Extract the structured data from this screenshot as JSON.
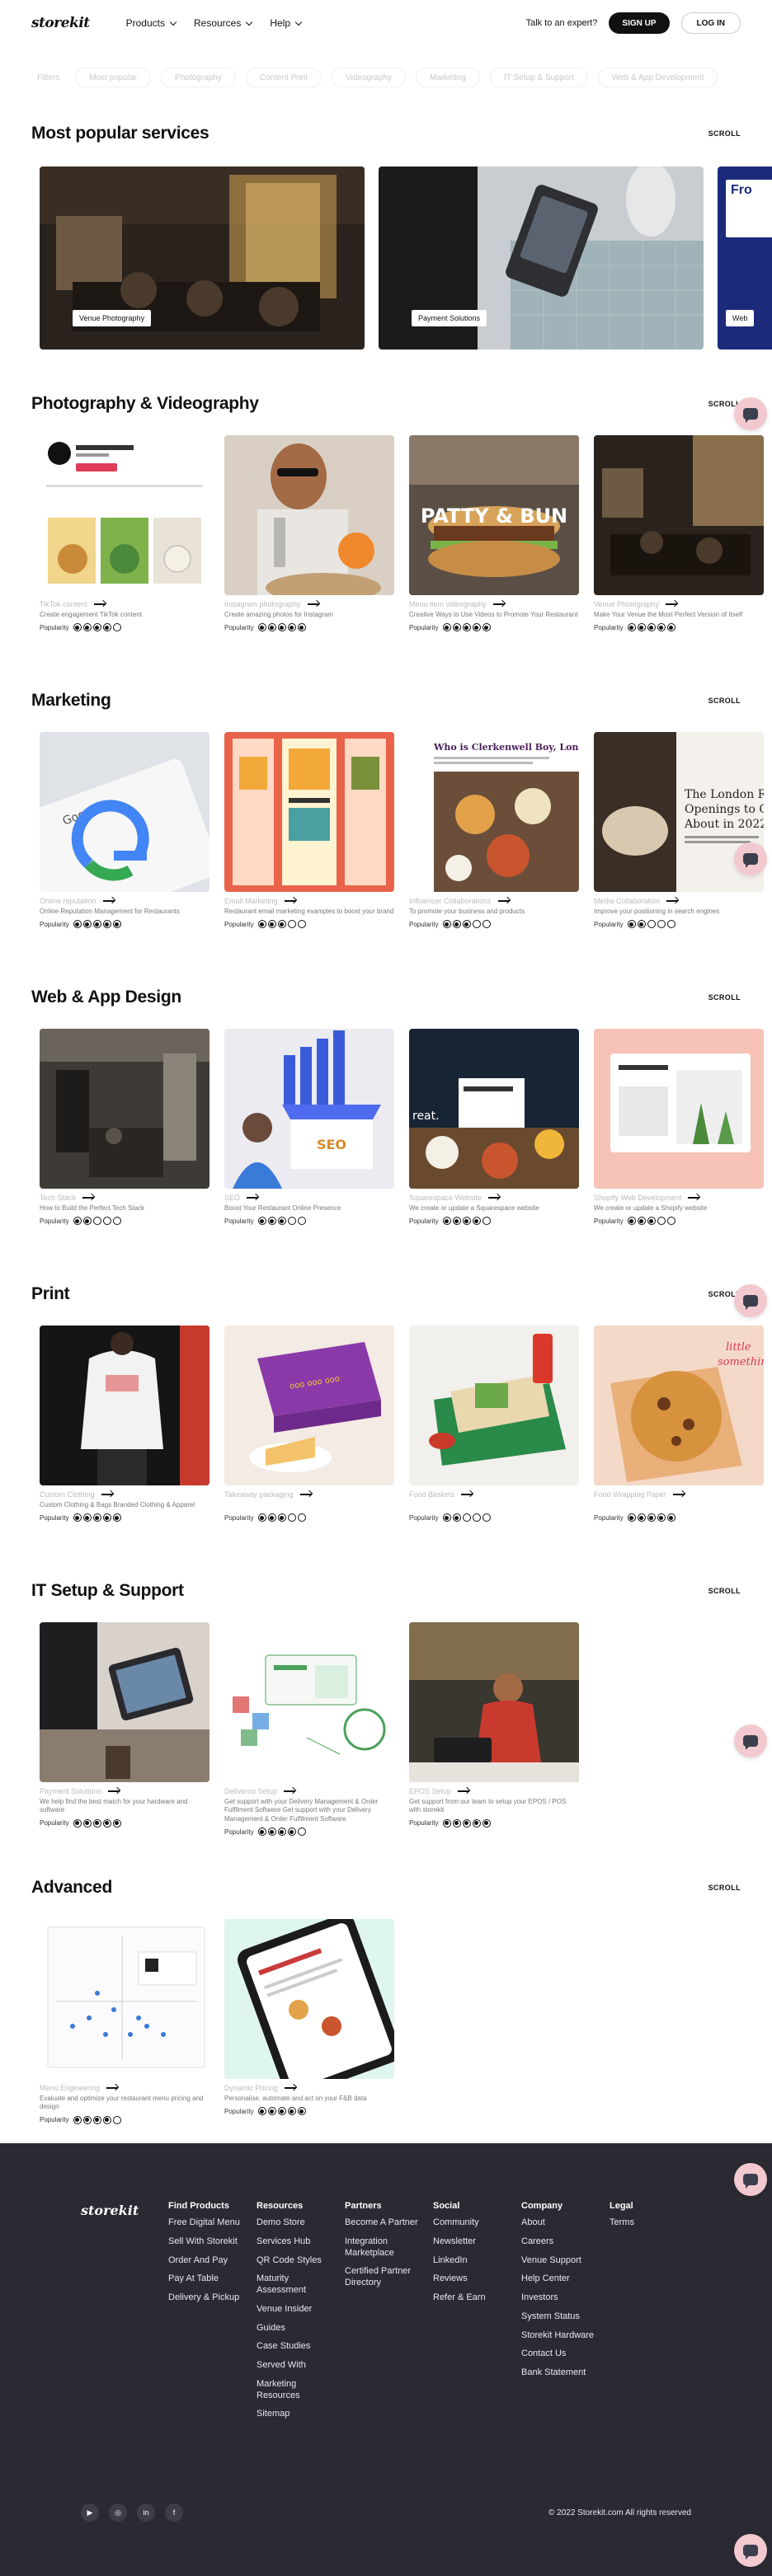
{
  "header": {
    "logo": "storekit",
    "nav": [
      "Products",
      "Resources",
      "Help"
    ],
    "talk": "Talk to an expert?",
    "signup": "SIGN UP",
    "login": "LOG IN"
  },
  "filters": [
    "Filters",
    "Most popular",
    "Photography",
    "Content Print",
    "Videography",
    "Marketing",
    "IT Setup & Support",
    "Web & App Development"
  ],
  "scroll_label": "SCROLL",
  "popular": {
    "title": "Most popular services",
    "cards": [
      {
        "label": "Venue Photography"
      },
      {
        "label": "Payment Solutions"
      },
      {
        "label": "Web"
      }
    ]
  },
  "popularity_label": "Popularity",
  "sections": [
    {
      "title": "Photography & Videography",
      "cards": [
        {
          "title": "TikTok content",
          "desc": "Create engagement TikTok content",
          "rating": 4
        },
        {
          "title": "Instagram photography",
          "desc": "Create amazing photos for Instagram",
          "rating": 5
        },
        {
          "title": "Menu item videography",
          "desc": "Creative Ways to Use Videos to Promote Your Restaurant",
          "rating": 5
        },
        {
          "title": "Venue Photography",
          "desc": "Make Your Venue the Most Perfect Version of Itself",
          "rating": 5
        }
      ]
    },
    {
      "title": "Marketing",
      "cards": [
        {
          "title": "Online reputation",
          "desc": "Online Reputation Management for Restaurants",
          "rating": 5
        },
        {
          "title": "Email Marketing",
          "desc": "Restaurant email marketing examples to boost your brand",
          "rating": 3
        },
        {
          "title": "Influencer Collaborations",
          "desc": "To promote your business and products",
          "rating": 3
        },
        {
          "title": "Media Collaboration",
          "desc": "Improve your positioning in search engines",
          "rating": 2
        }
      ]
    },
    {
      "title": "Web & App Design",
      "cards": [
        {
          "title": "Tech Stack",
          "desc": "How to Build the Perfect Tech Stack",
          "rating": 2
        },
        {
          "title": "SEO",
          "desc": "Boost Your Restaurant Online Presence",
          "rating": 3
        },
        {
          "title": "Squarespace Website",
          "desc": "We create or update a Squarespace website",
          "rating": 4
        },
        {
          "title": "Shopify Web Development",
          "desc": "We create or update a Shopify website",
          "rating": 3
        }
      ]
    },
    {
      "title": "Print",
      "cards": [
        {
          "title": "Custom Clothing",
          "desc": "Custom Clothing & Bags Branded Clothing & Apparel",
          "rating": 5
        },
        {
          "title": "Takeaway packaging",
          "desc": "",
          "rating": 3
        },
        {
          "title": "Food Baskets",
          "desc": "",
          "rating": 2
        },
        {
          "title": "Food Wrapping Paper",
          "desc": "",
          "rating": 5
        }
      ]
    },
    {
      "title": "IT Setup & Support",
      "cards": [
        {
          "title": "Payment Solutions",
          "desc": "We help find the best match for your hardware and software",
          "rating": 5
        },
        {
          "title": "Deliveroo Setup",
          "desc": "Get support with your Delivery Management & Order Fulfilment Software Get support with your Delivery Management & Order Fulfilment Software",
          "rating": 4
        },
        {
          "title": "EPOS Setup",
          "desc": "Get support from our team to setup your EPOS / POS with storekit",
          "rating": 5
        }
      ]
    },
    {
      "title": "Advanced",
      "cards": [
        {
          "title": "Menu Engineering",
          "desc": "Evaluate and optimize your restaurant menu pricing and design",
          "rating": 4
        },
        {
          "title": "Dynamic Pricing",
          "desc": "Personalise, automate and act on your F&B data",
          "rating": 5
        }
      ]
    }
  ],
  "footer": {
    "logo": "storekit",
    "columns": [
      {
        "heading": "Find Products",
        "links": [
          "Free Digital Menu",
          "Sell With Storekit",
          "Order And Pay",
          "Pay At Table",
          "Delivery & Pickup"
        ]
      },
      {
        "heading": "Resources",
        "links": [
          "Demo Store",
          "Services Hub",
          "QR Code Styles",
          "Maturity Assessment",
          "Venue Insider",
          "Guides",
          "Case Studies",
          "Served With",
          "Marketing Resources",
          "Sitemap"
        ]
      },
      {
        "heading": "Partners",
        "links": [
          "Become A Partner",
          "Integration Marketplace",
          "Certified Partner Directory"
        ]
      },
      {
        "heading": "Social",
        "links": [
          "Community",
          "Newsletter",
          "LinkedIn",
          "Reviews",
          "Refer & Earn"
        ]
      },
      {
        "heading": "Company",
        "links": [
          "About",
          "Careers",
          "Venue Support",
          "Help Center",
          "Investors",
          "System Status",
          "Storekit Hardware",
          "Contact Us",
          "Bank Statement"
        ]
      },
      {
        "heading": "Legal",
        "links": [
          "Terms"
        ]
      }
    ],
    "socials": [
      {
        "icon": "youtube-icon",
        "glyph": "▶"
      },
      {
        "icon": "instagram-icon",
        "glyph": "◎"
      },
      {
        "icon": "linkedin-icon",
        "glyph": "in"
      },
      {
        "icon": "facebook-icon",
        "glyph": "f"
      }
    ],
    "copyright": "© 2022 Storekit.com All rights reserved"
  },
  "colors": {
    "accent": "#111111",
    "footer_bg": "#2b2a33",
    "chat_bubble": "#f2c9cf"
  }
}
